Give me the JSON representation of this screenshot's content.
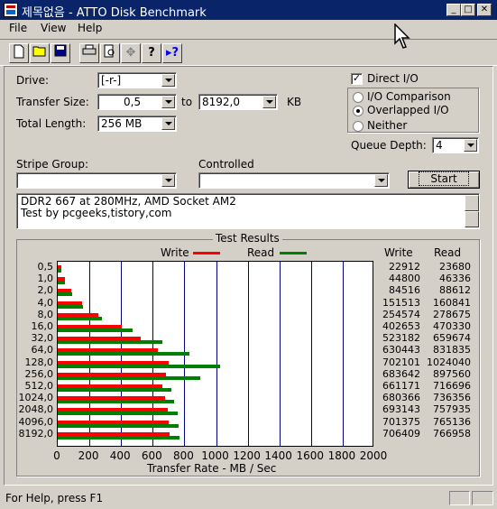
{
  "window": {
    "title": "제목없음 - ATTO Disk Benchmark",
    "min": "_",
    "max": "□",
    "close": "✕"
  },
  "menu": [
    "File",
    "View",
    "Help"
  ],
  "toolbar": [
    "new-icon",
    "open-icon",
    "save-icon",
    "print-icon",
    "print-preview-icon",
    "move-icon",
    "help-icon",
    "context-help-icon"
  ],
  "form": {
    "drive_label": "Drive:",
    "drive_value": "[-r-]",
    "transfer_label": "Transfer Size:",
    "transfer_from": "0,5",
    "transfer_to_label": "to",
    "transfer_to": "8192,0",
    "transfer_unit": "KB",
    "total_label": "Total Length:",
    "total_value": "256 MB",
    "direct_io": "Direct I/O",
    "radio_comparison": "I/O Comparison",
    "radio_overlapped": "Overlapped I/O",
    "radio_neither": "Neither",
    "queue_label": "Queue Depth:",
    "queue_value": "4",
    "stripe_label": "Stripe Group:",
    "controlled_label": "Controlled",
    "start_label": "Start",
    "notes_line1": "DDR2 667 at 280MHz, AMD Socket AM2",
    "notes_line2": "Test by pcgeeks,tistory,com"
  },
  "chart_data": {
    "type": "bar",
    "title": "Test Results",
    "xlabel": "Transfer Rate - MB / Sec",
    "xlim": [
      0,
      2000
    ],
    "xticks": [
      "0",
      "200",
      "400",
      "600",
      "800",
      "1000",
      "1200",
      "1400",
      "1600",
      "1800",
      "2000"
    ],
    "categories": [
      "0,5",
      "1,0",
      "2,0",
      "4,0",
      "8,0",
      "16,0",
      "32,0",
      "64,0",
      "128,0",
      "256,0",
      "512,0",
      "1024,0",
      "2048,0",
      "4096,0",
      "8192,0"
    ],
    "series": [
      {
        "name": "Write",
        "color": "#ff0000",
        "values": [
          22912,
          44800,
          84516,
          151513,
          254574,
          402653,
          523182,
          630443,
          702101,
          683642,
          661171,
          680366,
          693143,
          701375,
          706409
        ]
      },
      {
        "name": "Read",
        "color": "#008000",
        "values": [
          23680,
          46336,
          88612,
          160841,
          278675,
          470330,
          659674,
          831835,
          1024040,
          897560,
          716696,
          736356,
          757935,
          765136,
          766958
        ]
      }
    ],
    "write_header": "Write",
    "read_header": "Read"
  },
  "status": {
    "text": "For Help, press F1"
  }
}
